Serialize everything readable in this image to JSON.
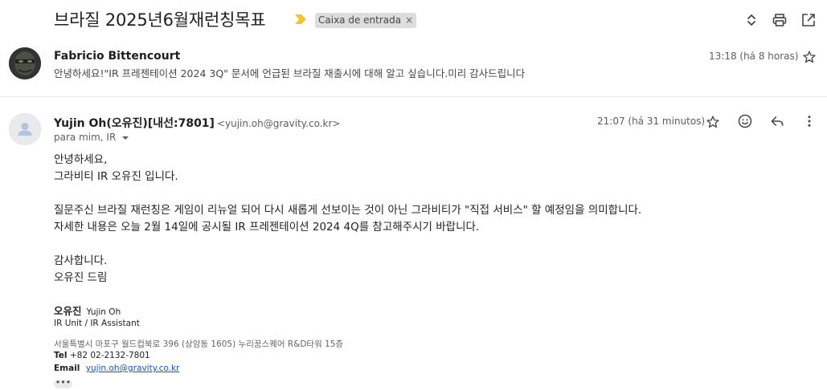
{
  "thread": {
    "subject": "브라질 2025년6월재런칭목표",
    "label": "Caixa de entrada",
    "label_close": "×"
  },
  "icons": {
    "importance": "importance-marker-icon",
    "expand": "expand-collapse-icon",
    "print": "print-icon",
    "open_new": "open-in-new-window-icon",
    "star": "star-icon",
    "emoji": "emoji-icon",
    "reply": "reply-icon",
    "more": "more-vert-icon"
  },
  "colors": {
    "importance_marker": "#f2c230",
    "link": "#1155cc",
    "chip_bg": "#dddddd"
  },
  "messages": [
    {
      "sender": "Fabricio Bittencourt",
      "snippet": "안녕하세요!\"IR 프레젠테이션 2024 3Q\" 문서에 언급된 브라질 재출시에 대해 알고 싶습니다.미리 감사드립니다",
      "time": "13:18 (há 8 horas)"
    },
    {
      "sender": "Yujin Oh(오유진)[내선:7801]",
      "email": "<yujin.oh@gravity.co.kr>",
      "to": "para mim, IR",
      "time": "21:07 (há 31 minutos)",
      "body": [
        "안녕하세요,",
        "그라비티 IR 오유진 입니다.",
        "질문주신 브라질 재런칭은 게임이 리뉴얼 되어 다시 새롭게 선보이는 것이 아닌  그라비티가 \"직접 서비스\" 할 예정임을 의미합니다.",
        "자세한 내용은 오늘 2월 14일에 공시될 IR 프레젠테이션 2024 4Q를 참고해주시기 바랍니다.",
        "감사합니다.",
        "오유진 드림"
      ],
      "signature": {
        "name_ko": "오유진",
        "name_en": "Yujin Oh",
        "title": "IR Unit / IR Assistant",
        "address": "서울특별시 마포구 월드컵북로 396 (상암동 1605) 누리꿈스퀘어 R&D타워 15층",
        "tel_label": "Tel",
        "tel": "+82 02-2132-7801",
        "email_label": "Email",
        "email": "yujin.oh@gravity.co.kr"
      },
      "trimmed_content": "•••"
    }
  ]
}
